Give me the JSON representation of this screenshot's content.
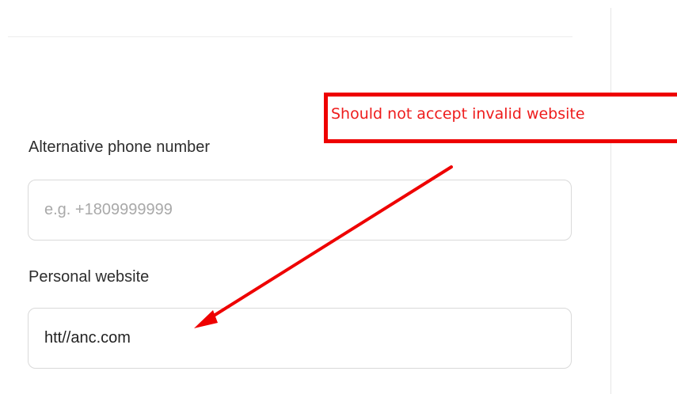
{
  "form": {
    "alt_phone": {
      "label": "Alternative phone number",
      "placeholder": "e.g. +1809999999",
      "value": ""
    },
    "website": {
      "label": "Personal website",
      "placeholder": "",
      "value": "htt//anc.com"
    }
  },
  "annotation": {
    "text": "Should not accept invalid website",
    "color": "#ee0000"
  }
}
